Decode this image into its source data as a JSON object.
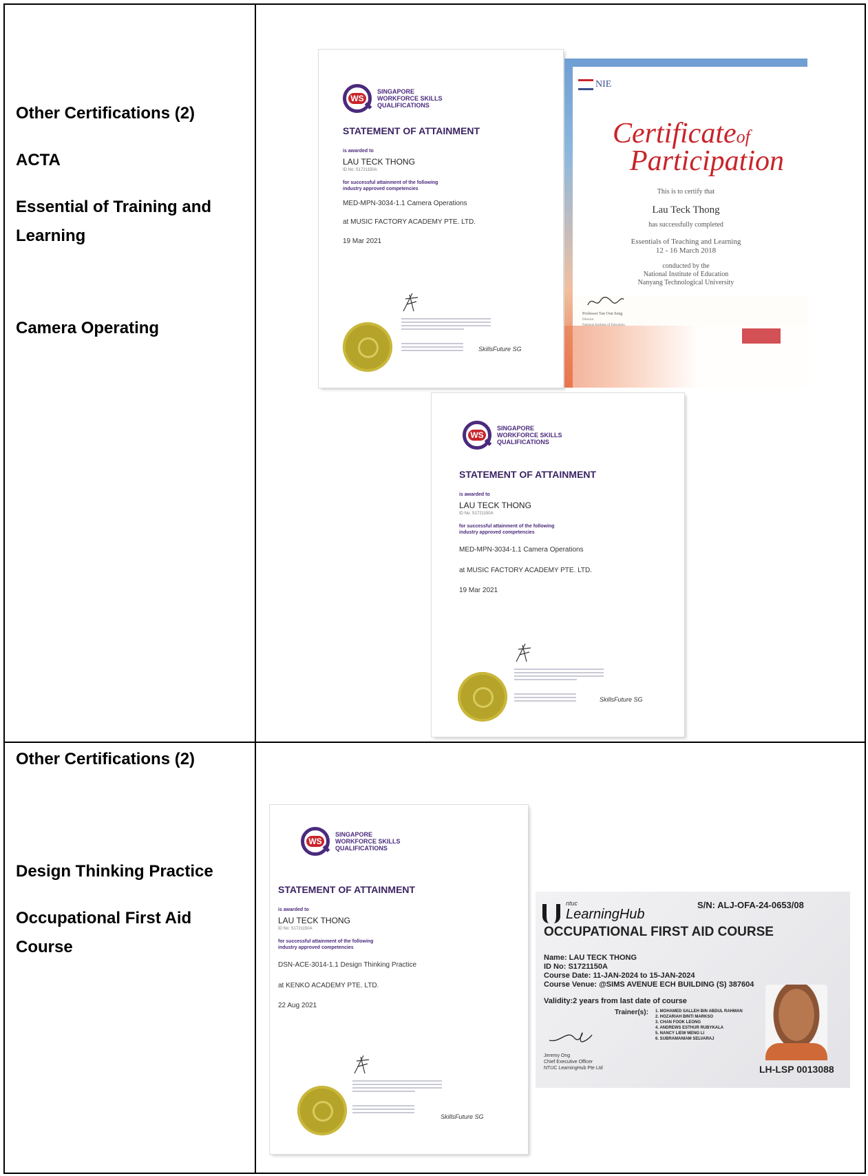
{
  "rows": [
    {
      "heading": "Other Certifications (2)",
      "items": [
        "ACTA",
        "Essential of Training and Learning",
        "Camera Operating"
      ]
    },
    {
      "heading": "Other Certifications (2)",
      "items": [
        "Design Thinking Practice",
        "Occupational First Aid Course"
      ]
    }
  ],
  "wsq": {
    "org": "SINGAPORE\nWORKFORCE SKILLS\nQUALIFICATIONS",
    "logo": "WS",
    "title": "STATEMENT OF ATTAINMENT",
    "awarded": "is awarded to",
    "name": "LAU TECK THONG",
    "id": "ID No: S1721150A",
    "successful": "for successful attainment of the following\nindustry approved competencies",
    "skillsfuture": "SkillsFuture SG"
  },
  "wsq_camera": {
    "competency": "MED-MPN-3034-1.1 Camera Operations",
    "provider": "at MUSIC FACTORY ACADEMY PTE. LTD.",
    "date": "19 Mar 2021"
  },
  "wsq_design": {
    "competency": "DSN-ACE-3014-1.1 Design Thinking Practice",
    "provider": "at KENKO ACADEMY PTE. LTD.",
    "date": "22 Aug 2021"
  },
  "nie": {
    "logo": "NIE",
    "title1": "Certificate",
    "title_of": "of",
    "title2": "Participation",
    "certify": "This is to certify that",
    "name": "Lau Teck Thong",
    "completed": "has successfully completed",
    "course": "Essentials of Teaching and Learning",
    "dates": "12 - 16 March 2018",
    "conducted": "conducted by the",
    "inst1": "National Institute of Education",
    "inst2": "Nanyang Technological University",
    "signer": "Professor Tan Oon Seng",
    "signer_title": "Director",
    "signer_org": "National Institute of Education"
  },
  "ntuc": {
    "brand_small": "ntuc",
    "brand": "LearningHub",
    "sn": "S/N: ALJ-OFA-24-0653/08",
    "course": "OCCUPATIONAL FIRST AID COURSE",
    "name": "Name:  LAU TECK THONG",
    "id": "ID No:  S1721150A",
    "date": "Course Date: 11-JAN-2024  to 15-JAN-2024",
    "venue": "Course Venue: @SIMS AVENUE ECH BUILDING  (S) 387604",
    "validity": "Validity:2 years from last date of course",
    "trainers_label": "Trainer(s):",
    "trainers": [
      "1. MOHAMED SALLEH BIN ABDUL RAHMAN",
      "2. HOZARIAH BINTI MARKSO",
      "3. CHAN FOOK LEONG",
      "4. ANDREWS ESTHUR RUBYKALA",
      "5. NANCY LIEW MENG LI",
      "6. SUBRAMANIAM SELVARAJ"
    ],
    "signer": "Jeremy Ong",
    "signer_title": "Chief Executive Officer",
    "signer_org": "NTUC LearningHub Pte Ltd",
    "ref": "LH-LSP 0013088"
  }
}
